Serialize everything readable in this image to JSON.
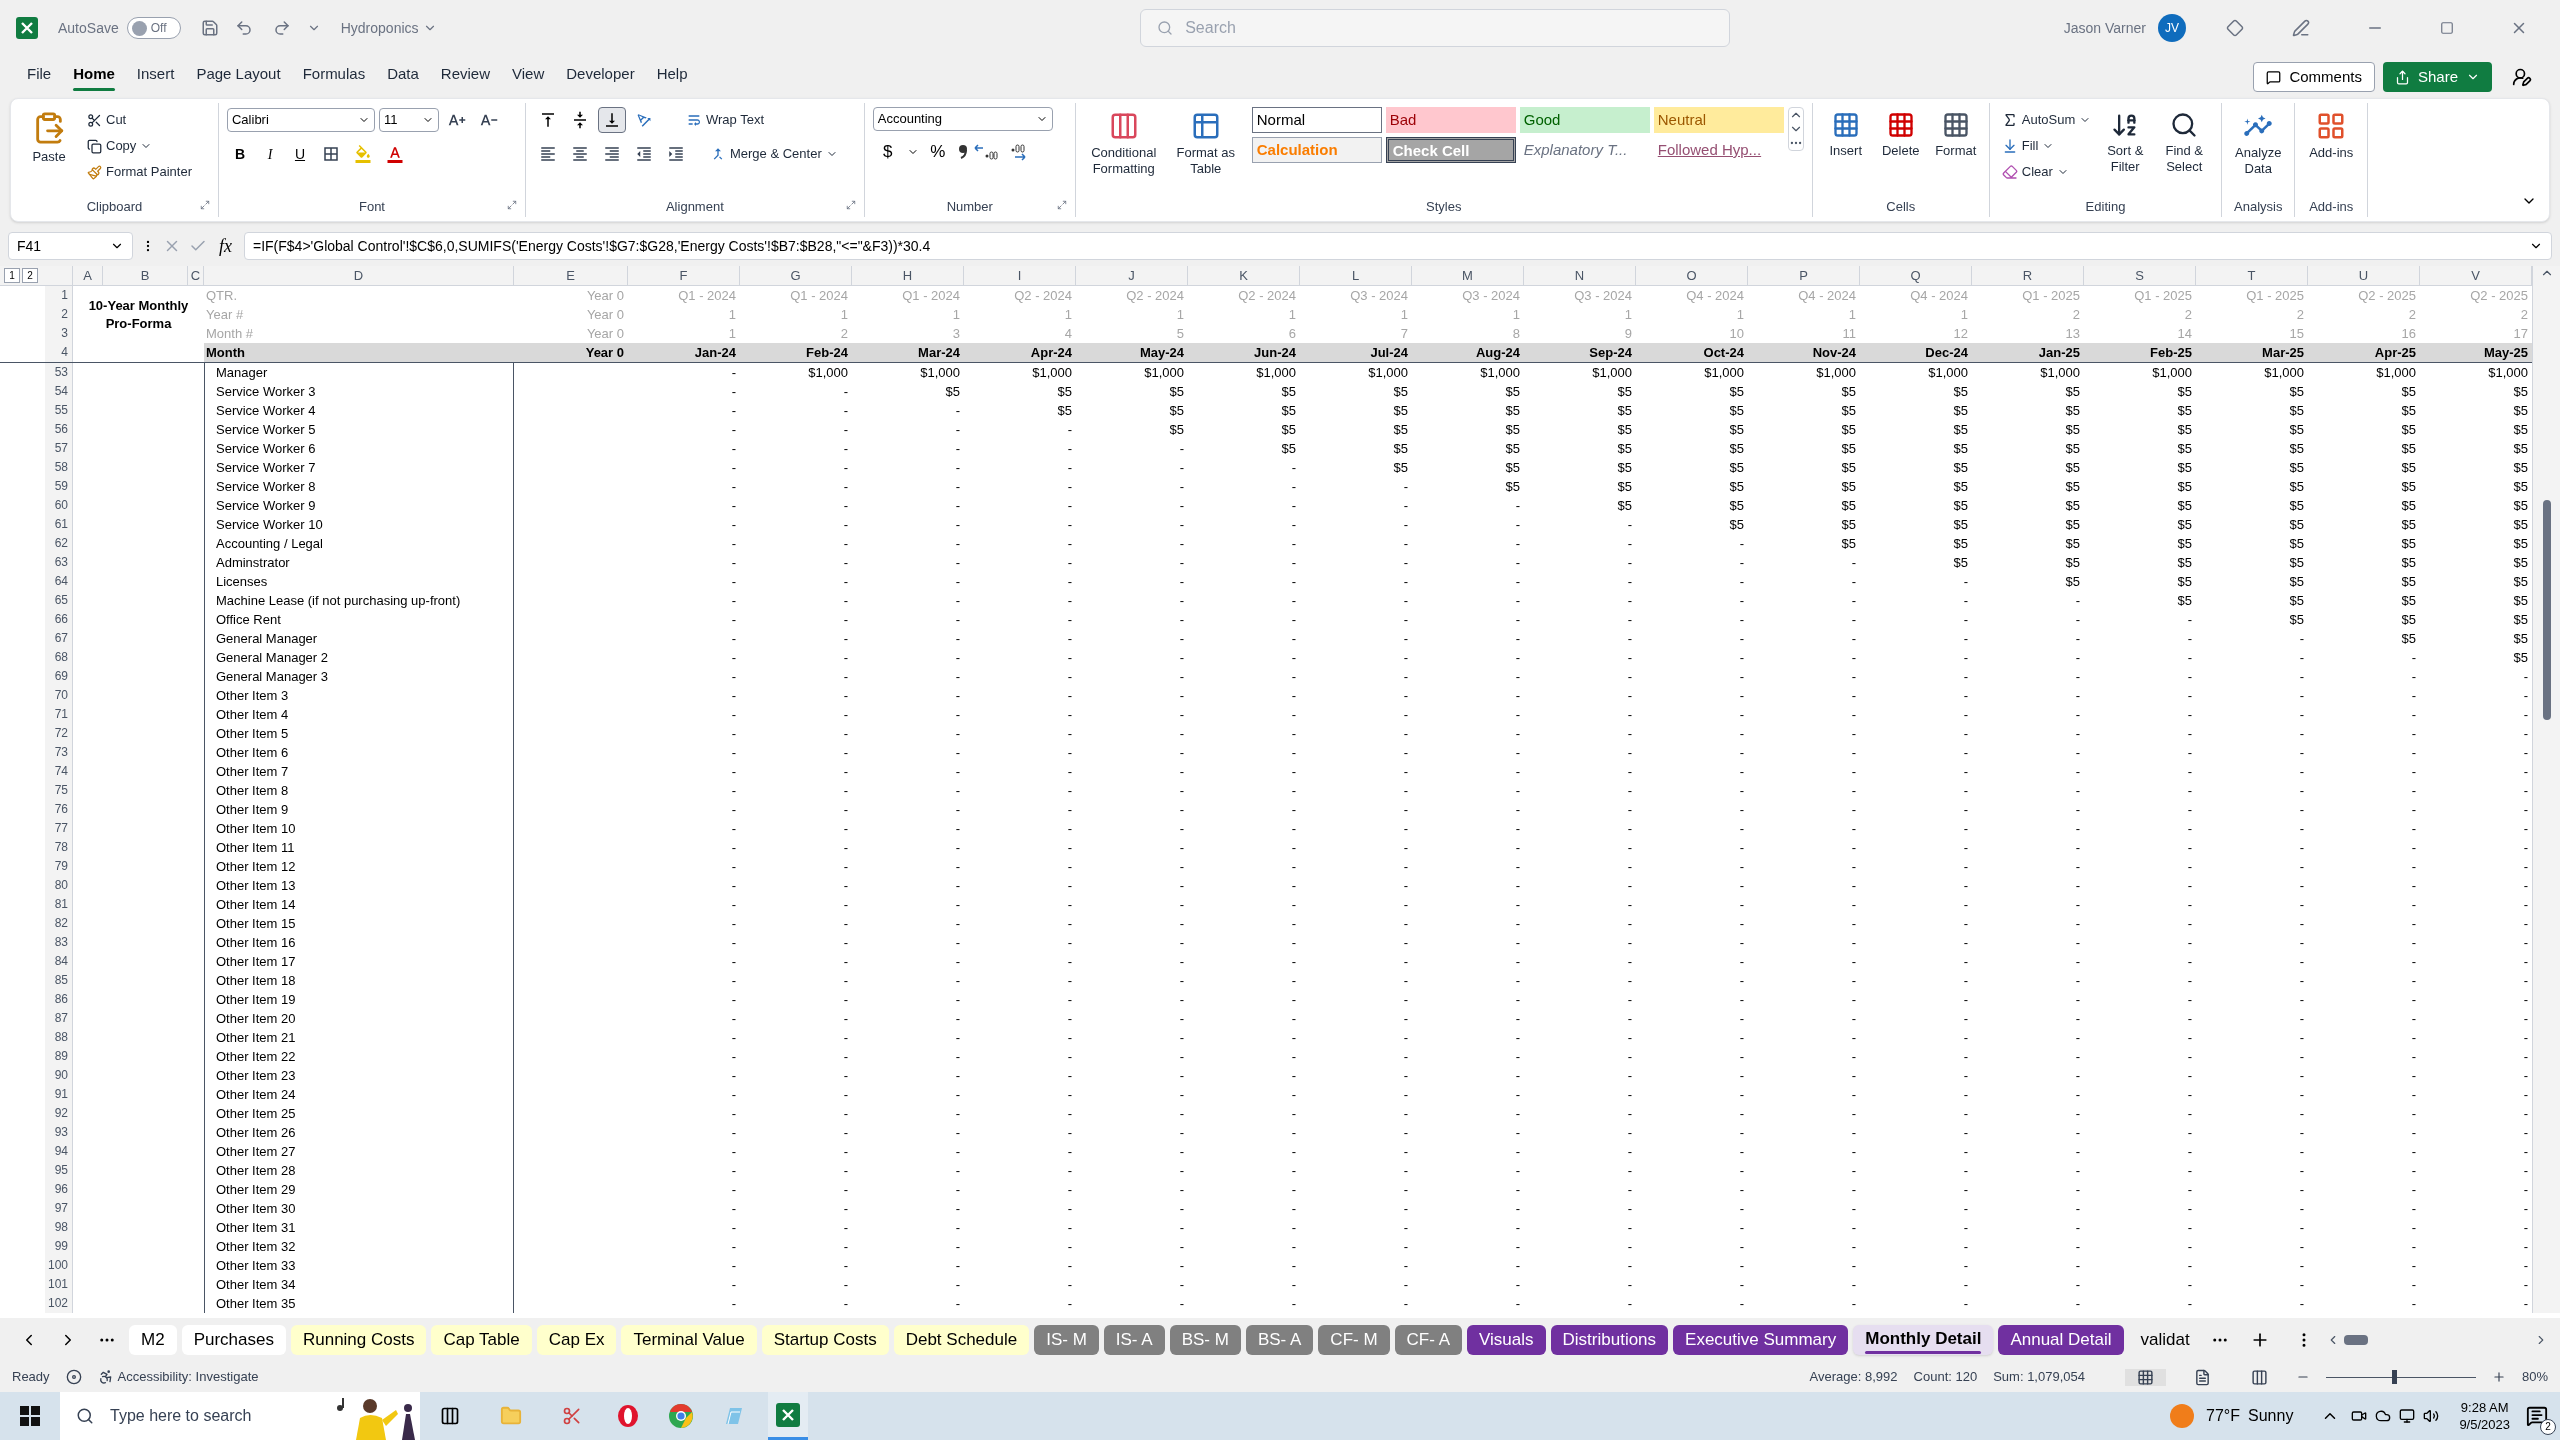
{
  "title_bar": {
    "autosave_label": "AutoSave",
    "autosave_on": false,
    "autosave_state": "Off",
    "document": "Hydroponics",
    "search_placeholder": "Search",
    "user": "Jason Varner",
    "user_initials": "JV"
  },
  "menu_tabs": [
    {
      "label": "File",
      "selected": false
    },
    {
      "label": "Home",
      "selected": true
    },
    {
      "label": "Insert",
      "selected": false
    },
    {
      "label": "Page Layout",
      "selected": false
    },
    {
      "label": "Formulas",
      "selected": false
    },
    {
      "label": "Data",
      "selected": false
    },
    {
      "label": "Review",
      "selected": false
    },
    {
      "label": "View",
      "selected": false
    },
    {
      "label": "Developer",
      "selected": false
    },
    {
      "label": "Help",
      "selected": false
    }
  ],
  "header_buttons": {
    "comments": "Comments",
    "share": "Share"
  },
  "ribbon": {
    "clipboard": {
      "paste": "Paste",
      "cut": "Cut",
      "copy": "Copy",
      "format_painter": "Format Painter",
      "label": "Clipboard"
    },
    "font": {
      "name": "Calibri",
      "size": "11",
      "bold": "B",
      "italic": "I",
      "underline": "U",
      "label": "Font"
    },
    "alignment": {
      "vertical": [
        {
          "kind": "top",
          "selected": false
        },
        {
          "kind": "middle",
          "selected": false
        },
        {
          "kind": "bottom",
          "selected": true
        }
      ],
      "wrap": "Wrap Text",
      "merge": "Merge & Center",
      "label": "Alignment"
    },
    "number": {
      "format": "Accounting",
      "currency": "$",
      "percent": "%",
      "label": "Number"
    },
    "styles": {
      "conditional": "Conditional Formatting",
      "format_table": "Format as Table",
      "label": "Styles",
      "gallery": [
        {
          "label": "Normal",
          "kind": "normal"
        },
        {
          "label": "Bad",
          "kind": "bad"
        },
        {
          "label": "Good",
          "kind": "good"
        },
        {
          "label": "Neutral",
          "kind": "neutral"
        },
        {
          "label": "Calculation",
          "kind": "calculation"
        },
        {
          "label": "Check Cell",
          "kind": "check"
        },
        {
          "label": "Explanatory T...",
          "kind": "explanatory"
        },
        {
          "label": "Followed Hyp...",
          "kind": "hyperlink"
        }
      ]
    },
    "cells": {
      "insert": "Insert",
      "delete": "Delete",
      "format": "Format",
      "label": "Cells"
    },
    "editing": {
      "autosum": "AutoSum",
      "fill": "Fill",
      "clear": "Clear",
      "sort": "Sort & Filter",
      "find": "Find & Select",
      "label": "Editing"
    },
    "analysis": {
      "analyze": "Analyze Data",
      "label": "Analysis"
    },
    "addins": {
      "addins": "Add-ins",
      "label": "Add-ins"
    }
  },
  "formula_bar": {
    "name_box": "F41",
    "function_label": "fx",
    "formula": "=IF(F$4>'Global Control'!$C$6,0,SUMIFS('Energy Costs'!$G7:$G28,'Energy Costs'!$B7:$B28,\"<=\"&F3))*30.4"
  },
  "sheet": {
    "outline_levels": [
      "1",
      "2"
    ],
    "column_letters": [
      "A",
      "B",
      "C",
      "D",
      "E",
      "F",
      "G",
      "H",
      "I",
      "J",
      "K",
      "L",
      "M",
      "N",
      "O",
      "P",
      "Q",
      "R",
      "S",
      "T",
      "U",
      "V"
    ],
    "title": "10-Year Monthly Pro-Forma",
    "header_rows": [
      {
        "num": "1",
        "label": "QTR.",
        "kind": "info",
        "cells": [
          "Year 0",
          "Q1 - 2024",
          "Q1 - 2024",
          "Q1 - 2024",
          "Q2 - 2024",
          "Q2 - 2024",
          "Q2 - 2024",
          "Q3 - 2024",
          "Q3 - 2024",
          "Q3 - 2024",
          "Q4 - 2024",
          "Q4 - 2024",
          "Q4 - 2024",
          "Q1 - 2025",
          "Q1 - 2025",
          "Q1 - 2025",
          "Q2 - 2025",
          "Q2 - 2025"
        ]
      },
      {
        "num": "2",
        "label": "Year #",
        "kind": "info",
        "cells": [
          "Year 0",
          "1",
          "1",
          "1",
          "1",
          "1",
          "1",
          "1",
          "1",
          "1",
          "1",
          "1",
          "1",
          "2",
          "2",
          "2",
          "2",
          "2"
        ]
      },
      {
        "num": "3",
        "label": "Month #",
        "kind": "info",
        "cells": [
          "Year 0",
          "1",
          "2",
          "3",
          "4",
          "5",
          "6",
          "7",
          "8",
          "9",
          "10",
          "11",
          "12",
          "13",
          "14",
          "15",
          "16",
          "17"
        ]
      },
      {
        "num": "4",
        "label": "Month",
        "kind": "heading",
        "cells": [
          "Year 0",
          "Jan-24",
          "Feb-24",
          "Mar-24",
          "Apr-24",
          "May-24",
          "Jun-24",
          "Jul-24",
          "Aug-24",
          "Sep-24",
          "Oct-24",
          "Nov-24",
          "Dec-24",
          "Jan-25",
          "Feb-25",
          "Mar-25",
          "Apr-25",
          "May-25"
        ]
      }
    ],
    "rows": [
      {
        "num": "53",
        "label": "Manager",
        "cells": [
          "-",
          "$1,000",
          "$1,000",
          "$1,000",
          "$1,000",
          "$1,000",
          "$1,000",
          "$1,000",
          "$1,000",
          "$1,000",
          "$1,000",
          "$1,000",
          "$1,000",
          "$1,000",
          "$1,000",
          "$1,000",
          "$1,000"
        ]
      },
      {
        "num": "54",
        "label": "Service Worker 3",
        "cells": [
          "-",
          "-",
          "$5",
          "$5",
          "$5",
          "$5",
          "$5",
          "$5",
          "$5",
          "$5",
          "$5",
          "$5",
          "$5",
          "$5",
          "$5",
          "$5",
          "$5"
        ]
      },
      {
        "num": "55",
        "label": "Service Worker 4",
        "cells": [
          "-",
          "-",
          "-",
          "$5",
          "$5",
          "$5",
          "$5",
          "$5",
          "$5",
          "$5",
          "$5",
          "$5",
          "$5",
          "$5",
          "$5",
          "$5",
          "$5"
        ]
      },
      {
        "num": "56",
        "label": "Service Worker 5",
        "cells": [
          "-",
          "-",
          "-",
          "-",
          "$5",
          "$5",
          "$5",
          "$5",
          "$5",
          "$5",
          "$5",
          "$5",
          "$5",
          "$5",
          "$5",
          "$5",
          "$5"
        ]
      },
      {
        "num": "57",
        "label": "Service Worker 6",
        "cells": [
          "-",
          "-",
          "-",
          "-",
          "-",
          "$5",
          "$5",
          "$5",
          "$5",
          "$5",
          "$5",
          "$5",
          "$5",
          "$5",
          "$5",
          "$5",
          "$5"
        ]
      },
      {
        "num": "58",
        "label": "Service Worker 7",
        "cells": [
          "-",
          "-",
          "-",
          "-",
          "-",
          "-",
          "$5",
          "$5",
          "$5",
          "$5",
          "$5",
          "$5",
          "$5",
          "$5",
          "$5",
          "$5",
          "$5"
        ]
      },
      {
        "num": "59",
        "label": "Service Worker 8",
        "cells": [
          "-",
          "-",
          "-",
          "-",
          "-",
          "-",
          "-",
          "$5",
          "$5",
          "$5",
          "$5",
          "$5",
          "$5",
          "$5",
          "$5",
          "$5",
          "$5"
        ]
      },
      {
        "num": "60",
        "label": "Service Worker 9",
        "cells": [
          "-",
          "-",
          "-",
          "-",
          "-",
          "-",
          "-",
          "-",
          "$5",
          "$5",
          "$5",
          "$5",
          "$5",
          "$5",
          "$5",
          "$5",
          "$5"
        ]
      },
      {
        "num": "61",
        "label": "Service Worker 10",
        "cells": [
          "-",
          "-",
          "-",
          "-",
          "-",
          "-",
          "-",
          "-",
          "-",
          "$5",
          "$5",
          "$5",
          "$5",
          "$5",
          "$5",
          "$5",
          "$5"
        ]
      },
      {
        "num": "62",
        "label": "Accounting / Legal",
        "cells": [
          "-",
          "-",
          "-",
          "-",
          "-",
          "-",
          "-",
          "-",
          "-",
          "-",
          "$5",
          "$5",
          "$5",
          "$5",
          "$5",
          "$5",
          "$5"
        ]
      },
      {
        "num": "63",
        "label": "Adminstrator",
        "cells": [
          "-",
          "-",
          "-",
          "-",
          "-",
          "-",
          "-",
          "-",
          "-",
          "-",
          "-",
          "$5",
          "$5",
          "$5",
          "$5",
          "$5",
          "$5"
        ]
      },
      {
        "num": "64",
        "label": "Licenses",
        "cells": [
          "-",
          "-",
          "-",
          "-",
          "-",
          "-",
          "-",
          "-",
          "-",
          "-",
          "-",
          "-",
          "$5",
          "$5",
          "$5",
          "$5",
          "$5"
        ]
      },
      {
        "num": "65",
        "label": "Machine Lease (if not purchasing up-front)",
        "cells": [
          "-",
          "-",
          "-",
          "-",
          "-",
          "-",
          "-",
          "-",
          "-",
          "-",
          "-",
          "-",
          "-",
          "$5",
          "$5",
          "$5",
          "$5"
        ]
      },
      {
        "num": "66",
        "label": "Office Rent",
        "cells": [
          "-",
          "-",
          "-",
          "-",
          "-",
          "-",
          "-",
          "-",
          "-",
          "-",
          "-",
          "-",
          "-",
          "-",
          "$5",
          "$5",
          "$5"
        ]
      },
      {
        "num": "67",
        "label": "General Manager",
        "cells": [
          "-",
          "-",
          "-",
          "-",
          "-",
          "-",
          "-",
          "-",
          "-",
          "-",
          "-",
          "-",
          "-",
          "-",
          "-",
          "$5",
          "$5"
        ]
      },
      {
        "num": "68",
        "label": "General Manager 2",
        "cells": [
          "-",
          "-",
          "-",
          "-",
          "-",
          "-",
          "-",
          "-",
          "-",
          "-",
          "-",
          "-",
          "-",
          "-",
          "-",
          "-",
          "$5"
        ]
      },
      {
        "num": "69",
        "label": "General Manager 3",
        "cells": [
          "-",
          "-",
          "-",
          "-",
          "-",
          "-",
          "-",
          "-",
          "-",
          "-",
          "-",
          "-",
          "-",
          "-",
          "-",
          "-",
          "-"
        ]
      },
      {
        "num": "70",
        "label": "Other Item 3",
        "cells": [
          "-",
          "-",
          "-",
          "-",
          "-",
          "-",
          "-",
          "-",
          "-",
          "-",
          "-",
          "-",
          "-",
          "-",
          "-",
          "-",
          "-"
        ]
      },
      {
        "num": "71",
        "label": "Other Item 4",
        "cells": [
          "-",
          "-",
          "-",
          "-",
          "-",
          "-",
          "-",
          "-",
          "-",
          "-",
          "-",
          "-",
          "-",
          "-",
          "-",
          "-",
          "-"
        ]
      },
      {
        "num": "72",
        "label": "Other Item 5",
        "cells": [
          "-",
          "-",
          "-",
          "-",
          "-",
          "-",
          "-",
          "-",
          "-",
          "-",
          "-",
          "-",
          "-",
          "-",
          "-",
          "-",
          "-"
        ]
      },
      {
        "num": "73",
        "label": "Other Item 6",
        "cells": [
          "-",
          "-",
          "-",
          "-",
          "-",
          "-",
          "-",
          "-",
          "-",
          "-",
          "-",
          "-",
          "-",
          "-",
          "-",
          "-",
          "-"
        ]
      },
      {
        "num": "74",
        "label": "Other Item 7",
        "cells": [
          "-",
          "-",
          "-",
          "-",
          "-",
          "-",
          "-",
          "-",
          "-",
          "-",
          "-",
          "-",
          "-",
          "-",
          "-",
          "-",
          "-"
        ]
      },
      {
        "num": "75",
        "label": "Other Item 8",
        "cells": [
          "-",
          "-",
          "-",
          "-",
          "-",
          "-",
          "-",
          "-",
          "-",
          "-",
          "-",
          "-",
          "-",
          "-",
          "-",
          "-",
          "-"
        ]
      },
      {
        "num": "76",
        "label": "Other Item 9",
        "cells": [
          "-",
          "-",
          "-",
          "-",
          "-",
          "-",
          "-",
          "-",
          "-",
          "-",
          "-",
          "-",
          "-",
          "-",
          "-",
          "-",
          "-"
        ]
      },
      {
        "num": "77",
        "label": "Other Item 10",
        "cells": [
          "-",
          "-",
          "-",
          "-",
          "-",
          "-",
          "-",
          "-",
          "-",
          "-",
          "-",
          "-",
          "-",
          "-",
          "-",
          "-",
          "-"
        ]
      },
      {
        "num": "78",
        "label": "Other Item 11",
        "cells": [
          "-",
          "-",
          "-",
          "-",
          "-",
          "-",
          "-",
          "-",
          "-",
          "-",
          "-",
          "-",
          "-",
          "-",
          "-",
          "-",
          "-"
        ]
      },
      {
        "num": "79",
        "label": "Other Item 12",
        "cells": [
          "-",
          "-",
          "-",
          "-",
          "-",
          "-",
          "-",
          "-",
          "-",
          "-",
          "-",
          "-",
          "-",
          "-",
          "-",
          "-",
          "-"
        ]
      },
      {
        "num": "80",
        "label": "Other Item 13",
        "cells": [
          "-",
          "-",
          "-",
          "-",
          "-",
          "-",
          "-",
          "-",
          "-",
          "-",
          "-",
          "-",
          "-",
          "-",
          "-",
          "-",
          "-"
        ]
      },
      {
        "num": "81",
        "label": "Other Item 14",
        "cells": [
          "-",
          "-",
          "-",
          "-",
          "-",
          "-",
          "-",
          "-",
          "-",
          "-",
          "-",
          "-",
          "-",
          "-",
          "-",
          "-",
          "-"
        ]
      },
      {
        "num": "82",
        "label": "Other Item 15",
        "cells": [
          "-",
          "-",
          "-",
          "-",
          "-",
          "-",
          "-",
          "-",
          "-",
          "-",
          "-",
          "-",
          "-",
          "-",
          "-",
          "-",
          "-"
        ]
      },
      {
        "num": "83",
        "label": "Other Item 16",
        "cells": [
          "-",
          "-",
          "-",
          "-",
          "-",
          "-",
          "-",
          "-",
          "-",
          "-",
          "-",
          "-",
          "-",
          "-",
          "-",
          "-",
          "-"
        ]
      },
      {
        "num": "84",
        "label": "Other Item 17",
        "cells": [
          "-",
          "-",
          "-",
          "-",
          "-",
          "-",
          "-",
          "-",
          "-",
          "-",
          "-",
          "-",
          "-",
          "-",
          "-",
          "-",
          "-"
        ]
      },
      {
        "num": "85",
        "label": "Other Item 18",
        "cells": [
          "-",
          "-",
          "-",
          "-",
          "-",
          "-",
          "-",
          "-",
          "-",
          "-",
          "-",
          "-",
          "-",
          "-",
          "-",
          "-",
          "-"
        ]
      },
      {
        "num": "86",
        "label": "Other Item 19",
        "cells": [
          "-",
          "-",
          "-",
          "-",
          "-",
          "-",
          "-",
          "-",
          "-",
          "-",
          "-",
          "-",
          "-",
          "-",
          "-",
          "-",
          "-"
        ]
      },
      {
        "num": "87",
        "label": "Other Item 20",
        "cells": [
          "-",
          "-",
          "-",
          "-",
          "-",
          "-",
          "-",
          "-",
          "-",
          "-",
          "-",
          "-",
          "-",
          "-",
          "-",
          "-",
          "-"
        ]
      },
      {
        "num": "88",
        "label": "Other Item 21",
        "cells": [
          "-",
          "-",
          "-",
          "-",
          "-",
          "-",
          "-",
          "-",
          "-",
          "-",
          "-",
          "-",
          "-",
          "-",
          "-",
          "-",
          "-"
        ]
      },
      {
        "num": "89",
        "label": "Other Item 22",
        "cells": [
          "-",
          "-",
          "-",
          "-",
          "-",
          "-",
          "-",
          "-",
          "-",
          "-",
          "-",
          "-",
          "-",
          "-",
          "-",
          "-",
          "-"
        ]
      },
      {
        "num": "90",
        "label": "Other Item 23",
        "cells": [
          "-",
          "-",
          "-",
          "-",
          "-",
          "-",
          "-",
          "-",
          "-",
          "-",
          "-",
          "-",
          "-",
          "-",
          "-",
          "-",
          "-"
        ]
      },
      {
        "num": "91",
        "label": "Other Item 24",
        "cells": [
          "-",
          "-",
          "-",
          "-",
          "-",
          "-",
          "-",
          "-",
          "-",
          "-",
          "-",
          "-",
          "-",
          "-",
          "-",
          "-",
          "-"
        ]
      },
      {
        "num": "92",
        "label": "Other Item 25",
        "cells": [
          "-",
          "-",
          "-",
          "-",
          "-",
          "-",
          "-",
          "-",
          "-",
          "-",
          "-",
          "-",
          "-",
          "-",
          "-",
          "-",
          "-"
        ]
      },
      {
        "num": "93",
        "label": "Other Item 26",
        "cells": [
          "-",
          "-",
          "-",
          "-",
          "-",
          "-",
          "-",
          "-",
          "-",
          "-",
          "-",
          "-",
          "-",
          "-",
          "-",
          "-",
          "-"
        ]
      },
      {
        "num": "94",
        "label": "Other Item 27",
        "cells": [
          "-",
          "-",
          "-",
          "-",
          "-",
          "-",
          "-",
          "-",
          "-",
          "-",
          "-",
          "-",
          "-",
          "-",
          "-",
          "-",
          "-"
        ]
      },
      {
        "num": "95",
        "label": "Other Item 28",
        "cells": [
          "-",
          "-",
          "-",
          "-",
          "-",
          "-",
          "-",
          "-",
          "-",
          "-",
          "-",
          "-",
          "-",
          "-",
          "-",
          "-",
          "-"
        ]
      },
      {
        "num": "96",
        "label": "Other Item 29",
        "cells": [
          "-",
          "-",
          "-",
          "-",
          "-",
          "-",
          "-",
          "-",
          "-",
          "-",
          "-",
          "-",
          "-",
          "-",
          "-",
          "-",
          "-"
        ]
      },
      {
        "num": "97",
        "label": "Other Item 30",
        "cells": [
          "-",
          "-",
          "-",
          "-",
          "-",
          "-",
          "-",
          "-",
          "-",
          "-",
          "-",
          "-",
          "-",
          "-",
          "-",
          "-",
          "-"
        ]
      },
      {
        "num": "98",
        "label": "Other Item 31",
        "cells": [
          "-",
          "-",
          "-",
          "-",
          "-",
          "-",
          "-",
          "-",
          "-",
          "-",
          "-",
          "-",
          "-",
          "-",
          "-",
          "-",
          "-"
        ]
      },
      {
        "num": "99",
        "label": "Other Item 32",
        "cells": [
          "-",
          "-",
          "-",
          "-",
          "-",
          "-",
          "-",
          "-",
          "-",
          "-",
          "-",
          "-",
          "-",
          "-",
          "-",
          "-",
          "-"
        ]
      },
      {
        "num": "100",
        "label": "Other Item 33",
        "cells": [
          "-",
          "-",
          "-",
          "-",
          "-",
          "-",
          "-",
          "-",
          "-",
          "-",
          "-",
          "-",
          "-",
          "-",
          "-",
          "-",
          "-"
        ]
      },
      {
        "num": "101",
        "label": "Other Item 34",
        "cells": [
          "-",
          "-",
          "-",
          "-",
          "-",
          "-",
          "-",
          "-",
          "-",
          "-",
          "-",
          "-",
          "-",
          "-",
          "-",
          "-",
          "-"
        ]
      },
      {
        "num": "102",
        "label": "Other Item 35",
        "cells": [
          "-",
          "-",
          "-",
          "-",
          "-",
          "-",
          "-",
          "-",
          "-",
          "-",
          "-",
          "-",
          "-",
          "-",
          "-",
          "-",
          "-"
        ]
      }
    ]
  },
  "sheet_tabs": [
    {
      "label": "M2",
      "color": "#ffffff",
      "selected": false
    },
    {
      "label": "Purchases",
      "color": "#ffffff",
      "selected": false
    },
    {
      "label": "Running Costs",
      "color": "#ffffcc",
      "selected": false
    },
    {
      "label": "Cap Table",
      "color": "#ffffcc",
      "selected": false
    },
    {
      "label": "Cap Ex",
      "color": "#ffffcc",
      "selected": false
    },
    {
      "label": "Terminal Value",
      "color": "#ffffcc",
      "selected": false
    },
    {
      "label": "Startup Costs",
      "color": "#ffffcc",
      "selected": false
    },
    {
      "label": "Debt Schedule",
      "color": "#ffffcc",
      "selected": false
    },
    {
      "label": "IS- M",
      "color": "#808080",
      "selected": false
    },
    {
      "label": "IS- A",
      "color": "#808080",
      "selected": false
    },
    {
      "label": "BS- M",
      "color": "#808080",
      "selected": false
    },
    {
      "label": "BS- A",
      "color": "#808080",
      "selected": false
    },
    {
      "label": "CF- M",
      "color": "#808080",
      "selected": false
    },
    {
      "label": "CF- A",
      "color": "#808080",
      "selected": false
    },
    {
      "label": "Visuals",
      "color": "#7030a0",
      "selected": false
    },
    {
      "label": "Distributions",
      "color": "#7030a0",
      "selected": false
    },
    {
      "label": "Executive Summary",
      "color": "#7030a0",
      "selected": false
    },
    {
      "label": "Monthly Detail",
      "color": "#7030a0",
      "selected": true
    },
    {
      "label": "Annual Detail",
      "color": "#7030a0",
      "selected": false
    },
    {
      "label": "validat",
      "selected": false
    }
  ],
  "status_bar": {
    "mode": "Ready",
    "accessibility": "Accessibility: Investigate",
    "average": "Average: 8,992",
    "count": "Count: 120",
    "sum": "Sum: 1,079,054",
    "zoom": {
      "level": 0.44,
      "reading": "80%"
    }
  },
  "taskbar": {
    "search_placeholder": "Type here to search",
    "temperature": "77°F",
    "weather": "Sunny",
    "time": "9:28 AM",
    "date": "9/5/2023",
    "notifications": "2"
  }
}
